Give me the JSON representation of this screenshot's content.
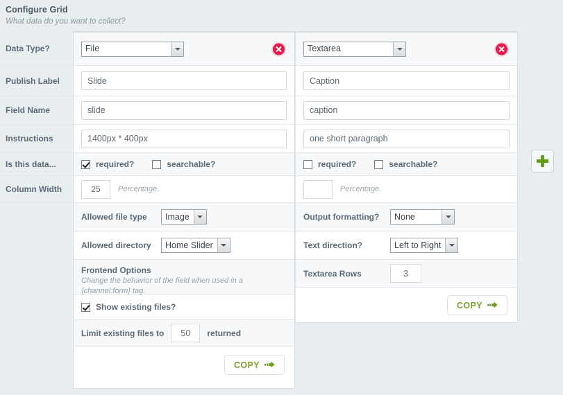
{
  "header": {
    "title": "Configure Grid",
    "subtitle": "What data do you want to collect?"
  },
  "row_labels": [
    "Data Type?",
    "Publish Label",
    "Field Name",
    "Instructions",
    "Is this data...",
    "Column Width"
  ],
  "columns": [
    {
      "id": "column-1",
      "data_type": "File",
      "publish_label": "Slide",
      "field_name": "slide",
      "instructions": "1400px * 400px",
      "required": {
        "label": "required?",
        "checked": true
      },
      "searchable": {
        "label": "searchable?",
        "checked": false
      },
      "column_width": "25",
      "column_width_hint": "Percentage.",
      "extras": [
        {
          "label": "Allowed file type",
          "type": "select",
          "value": "Image"
        },
        {
          "label": "Allowed directory",
          "type": "select",
          "value": "Home Slider"
        }
      ],
      "frontend": {
        "title": "Frontend Options",
        "description_line1": "Change the behavior of the field when used in a",
        "description_line2": "{channel:form} tag.",
        "show_existing": {
          "label": "Show existing files?",
          "checked": true
        },
        "limit_prefix": "Limit existing files to",
        "limit_value": "50",
        "limit_suffix": "returned"
      },
      "copy_label": "COPY",
      "delete_title": "Remove column"
    },
    {
      "id": "column-2",
      "data_type": "Textarea",
      "publish_label": "Caption",
      "field_name": "caption",
      "instructions": "one short paragraph",
      "required": {
        "label": "required?",
        "checked": false
      },
      "searchable": {
        "label": "searchable?",
        "checked": false
      },
      "column_width": "",
      "column_width_hint": "Percentage.",
      "extras": [
        {
          "label": "Output formatting?",
          "type": "select",
          "value": "None"
        },
        {
          "label": "Text direction?",
          "type": "select",
          "value": "Left to Right"
        },
        {
          "label": "Textarea Rows",
          "type": "number",
          "value": "3"
        }
      ],
      "copy_label": "COPY",
      "delete_title": "Remove column"
    }
  ],
  "add_column_button": {
    "icon": "plus-icon",
    "title": "Add column"
  },
  "colors": {
    "accent_green": "#7aa02e",
    "delete_red": "#e8174c",
    "page_bg": "#e8edf0",
    "label_text": "#5c6b78"
  }
}
